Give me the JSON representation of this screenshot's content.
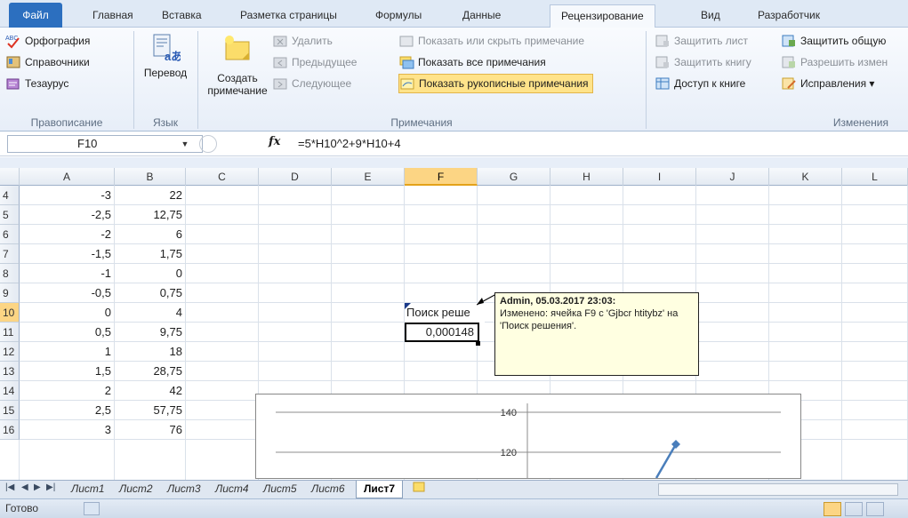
{
  "tabs": [
    "Файл",
    "Главная",
    "Вставка",
    "Разметка страницы",
    "Формулы",
    "Данные",
    "Рецензирование",
    "Вид",
    "Разработчик"
  ],
  "ribbon": {
    "spelling": "Орфография",
    "references": "Справочники",
    "thesaurus": "Тезаурус",
    "group_proofing": "Правописание",
    "translate": "Перевод",
    "group_language": "Язык",
    "new_comment_1": "Создать",
    "new_comment_2": "примечание",
    "delete": "Удалить",
    "previous": "Предыдущее",
    "next": "Следующее",
    "show_hide": "Показать или скрыть примечание",
    "show_all": "Показать все примечания",
    "show_ink": "Показать рукописные примечания",
    "group_comments": "Примечания",
    "protect_sheet": "Защитить лист",
    "protect_book": "Защитить книгу",
    "share_book": "Доступ к книге",
    "protect_shared": "Защитить общую",
    "allow_edit": "Разрешить измен",
    "track_changes": "Исправления ▾",
    "group_changes": "Изменения"
  },
  "formula_bar": {
    "name_box": "F10",
    "fx": "fx",
    "formula": "=5*H10^2+9*H10+4"
  },
  "columns": [
    "A",
    "B",
    "C",
    "D",
    "E",
    "F",
    "G",
    "H",
    "I",
    "J",
    "K",
    "L"
  ],
  "rows": [
    {
      "n": "4",
      "a": "-3",
      "b": "22"
    },
    {
      "n": "5",
      "a": "-2,5",
      "b": "12,75"
    },
    {
      "n": "6",
      "a": "-2",
      "b": "6"
    },
    {
      "n": "7",
      "a": "-1,5",
      "b": "1,75"
    },
    {
      "n": "8",
      "a": "-1",
      "b": "0"
    },
    {
      "n": "9",
      "a": "-0,5",
      "b": "0,75"
    },
    {
      "n": "10",
      "a": "0",
      "b": "4"
    },
    {
      "n": "11",
      "a": "0,5",
      "b": "9,75"
    },
    {
      "n": "12",
      "a": "1",
      "b": "18"
    },
    {
      "n": "13",
      "a": "1,5",
      "b": "28,75"
    },
    {
      "n": "14",
      "a": "2",
      "b": "42"
    },
    {
      "n": "15",
      "a": "2,5",
      "b": "57,75"
    },
    {
      "n": "16",
      "a": "3",
      "b": "76"
    }
  ],
  "cells": {
    "f9": "Поиск реше",
    "f10": "0,000148"
  },
  "comment": {
    "author": "Admin, 05.03.2017 23:03:",
    "text": "Изменено: ячейка F9 с 'Gjbcr htitybz' на 'Поиск решения'."
  },
  "chart_data": {
    "type": "line",
    "y_ticks": [
      "140",
      "120"
    ],
    "ylim": [
      120,
      140
    ]
  },
  "sheets": [
    "Лист1",
    "Лист2",
    "Лист3",
    "Лист4",
    "Лист5",
    "Лист6",
    "Лист7"
  ],
  "active_sheet": "Лист7",
  "status": "Готово"
}
